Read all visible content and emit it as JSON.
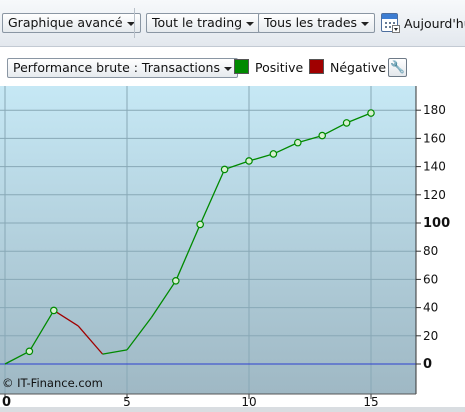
{
  "toolbar": {
    "chart_mode": "Graphique avancé",
    "trading_filter": "Tout le trading",
    "trades_filter": "Tous les trades",
    "date_label": "Aujourd'hu"
  },
  "metric_select": "Performance brute : Transactions",
  "legend": {
    "positive_label": "Positive",
    "positive_color": "#008a00",
    "negative_label": "Négative",
    "negative_color": "#a00000"
  },
  "credit": "© IT-Finance.com",
  "chart_data": {
    "type": "line",
    "title": "",
    "xlabel": "",
    "ylabel": "",
    "xlim": [
      0,
      17
    ],
    "ylim": [
      -10,
      190
    ],
    "x_ticks": [
      "0",
      "5",
      "10",
      "15"
    ],
    "y_ticks": [
      "0",
      "20",
      "40",
      "60",
      "80",
      "100",
      "120",
      "140",
      "160",
      "180"
    ],
    "y_axis_side": "right",
    "grid": true,
    "background_gradient": [
      "#c6e8f5",
      "#9fb8c4"
    ],
    "series": [
      {
        "points": [
          {
            "x": 0,
            "y": 0,
            "marker": false
          },
          {
            "x": 1,
            "y": 9,
            "marker": true
          },
          {
            "x": 2,
            "y": 38,
            "marker": true
          },
          {
            "x": 3,
            "y": 27,
            "marker": false
          },
          {
            "x": 4,
            "y": 7,
            "marker": false
          },
          {
            "x": 5,
            "y": 10,
            "marker": false
          },
          {
            "x": 6,
            "y": 33,
            "marker": false
          },
          {
            "x": 7,
            "y": 59,
            "marker": true
          },
          {
            "x": 8,
            "y": 99,
            "marker": true
          },
          {
            "x": 9,
            "y": 138,
            "marker": true
          },
          {
            "x": 10,
            "y": 144,
            "marker": true
          },
          {
            "x": 11,
            "y": 149,
            "marker": true
          },
          {
            "x": 12,
            "y": 157,
            "marker": true
          },
          {
            "x": 13,
            "y": 162,
            "marker": true
          },
          {
            "x": 14,
            "y": 171,
            "marker": true
          },
          {
            "x": 15,
            "y": 178,
            "marker": true
          }
        ]
      }
    ]
  }
}
